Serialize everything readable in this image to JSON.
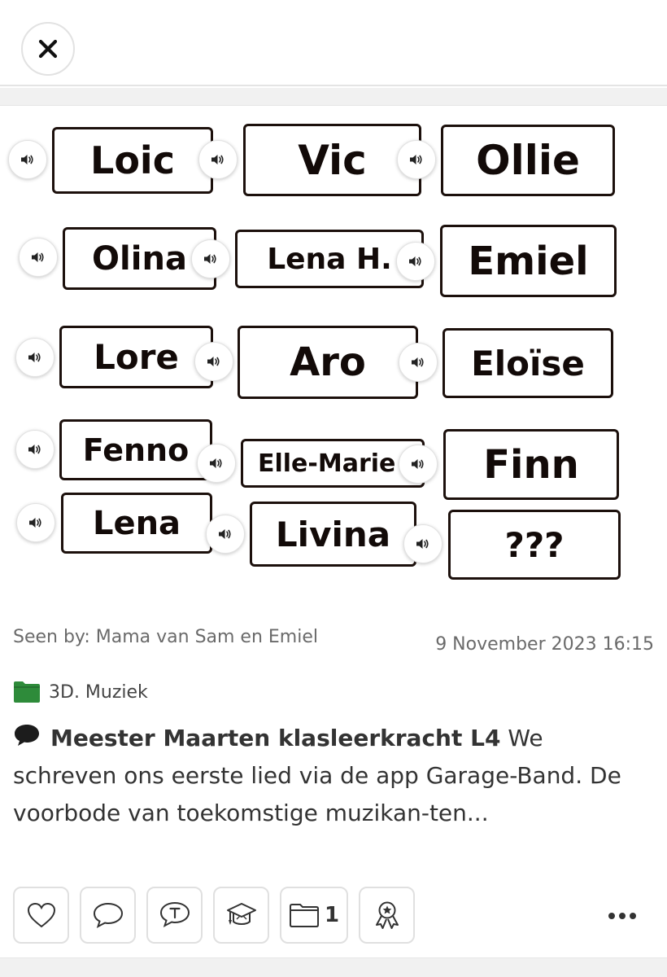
{
  "cards": [
    {
      "text": "Loic"
    },
    {
      "text": "Vic"
    },
    {
      "text": "Ollie"
    },
    {
      "text": "Olina"
    },
    {
      "text": "Lena H."
    },
    {
      "text": "Emiel"
    },
    {
      "text": "Lore"
    },
    {
      "text": "Aro"
    },
    {
      "text": "Eloïse"
    },
    {
      "text": "Fenno"
    },
    {
      "text": "Elle-Marie"
    },
    {
      "text": "Finn"
    },
    {
      "text": "Lena"
    },
    {
      "text": "Livina"
    },
    {
      "text": "???"
    }
  ],
  "meta": {
    "seen_by": "Seen by: Mama van Sam en Emiel",
    "date": "9 November 2023 16:15"
  },
  "folder": {
    "label": "3D. Muziek",
    "color": "#2e8b3a"
  },
  "post": {
    "author": "Meester Maarten klasleerkracht L4",
    "text": " We schreven ons eerste lied via de app Garage-Band. De voorbode van toekomstige muzikan-ten..."
  },
  "actions": {
    "folder_count": "1"
  },
  "icons": {
    "close": "close-icon",
    "speaker": "speaker-icon",
    "folder": "folder-icon",
    "comment": "speech-bubble-icon",
    "like": "heart-icon",
    "reply": "comment-icon",
    "translate": "translate-icon",
    "education": "graduation-cap-icon",
    "folder_action": "folder-icon",
    "badge": "award-badge-icon",
    "more": "more-icon"
  }
}
